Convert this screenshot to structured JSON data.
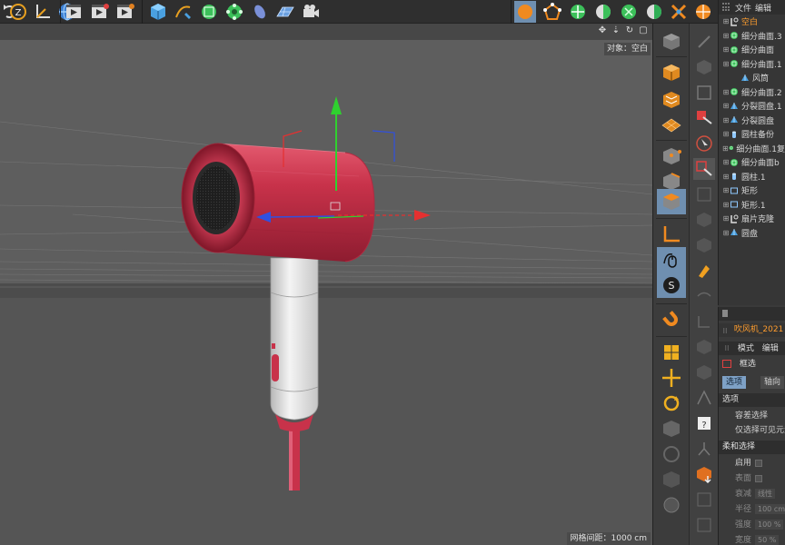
{
  "object_manager": {
    "menu": [
      "文件",
      "编辑"
    ],
    "objects": [
      {
        "label": "空白",
        "indent": 0,
        "icon": "null-icon",
        "highlight": true
      },
      {
        "label": "细分曲面.3",
        "indent": 0,
        "icon": "subdivision-icon"
      },
      {
        "label": "细分曲面",
        "indent": 0,
        "icon": "subdivision-icon"
      },
      {
        "label": "细分曲面.1",
        "indent": 0,
        "icon": "subdivision-icon"
      },
      {
        "label": "风筒",
        "indent": 1,
        "icon": "polygon-icon"
      },
      {
        "label": "细分曲面.2",
        "indent": 0,
        "icon": "subdivision-icon"
      },
      {
        "label": "分裂圆盘.1",
        "indent": 0,
        "icon": "polygon-icon"
      },
      {
        "label": "分裂圆盘",
        "indent": 0,
        "icon": "polygon-icon"
      },
      {
        "label": "圆柱备份",
        "indent": 0,
        "icon": "cylinder-icon"
      },
      {
        "label": "细分曲面.1复",
        "indent": 0,
        "icon": "subdivision-icon"
      },
      {
        "label": "细分曲面b",
        "indent": 0,
        "icon": "subdivision-icon"
      },
      {
        "label": "圆柱.1",
        "indent": 0,
        "icon": "cylinder-icon"
      },
      {
        "label": "矩形",
        "indent": 0,
        "icon": "rectangle-spline-icon"
      },
      {
        "label": "矩形.1",
        "indent": 0,
        "icon": "rectangle-spline-icon"
      },
      {
        "label": "扇片克隆",
        "indent": 0,
        "icon": "null-icon"
      },
      {
        "label": "圆盘",
        "indent": 0,
        "icon": "polygon-icon"
      }
    ]
  },
  "attribute_manager": {
    "title": "吹风机_2021",
    "menu": [
      "模式",
      "编辑"
    ],
    "tool_name": "框选",
    "tabs": [
      "选项",
      "轴向"
    ],
    "section_options": "选项",
    "option_items": [
      "容差选择",
      "仅选择可见元素"
    ],
    "section_soft": "柔和选择",
    "fields": [
      {
        "label": "启用",
        "kind": "checkbox"
      },
      {
        "label": "表面",
        "kind": "checkbox"
      },
      {
        "label": "衰减",
        "kind": "value",
        "value": "线性"
      },
      {
        "label": "半径",
        "kind": "value",
        "value": "100 cm"
      },
      {
        "label": "强度",
        "kind": "value",
        "value": "100 %"
      },
      {
        "label": "宽度",
        "kind": "value",
        "value": "50 %"
      }
    ]
  },
  "viewport": {
    "camera_label": "对象：空白",
    "grid_label": "网格间距：1000 cm"
  },
  "colors": {
    "hairdryer_body": "#c8324a",
    "hairdryer_handle": "#e4e4e4",
    "axis_y": "#2fd12f",
    "axis_x": "#e53030",
    "axis_z": "#3050e0",
    "active_tool": "#6f8fb0",
    "highlight_text": "#ff9d2e"
  }
}
